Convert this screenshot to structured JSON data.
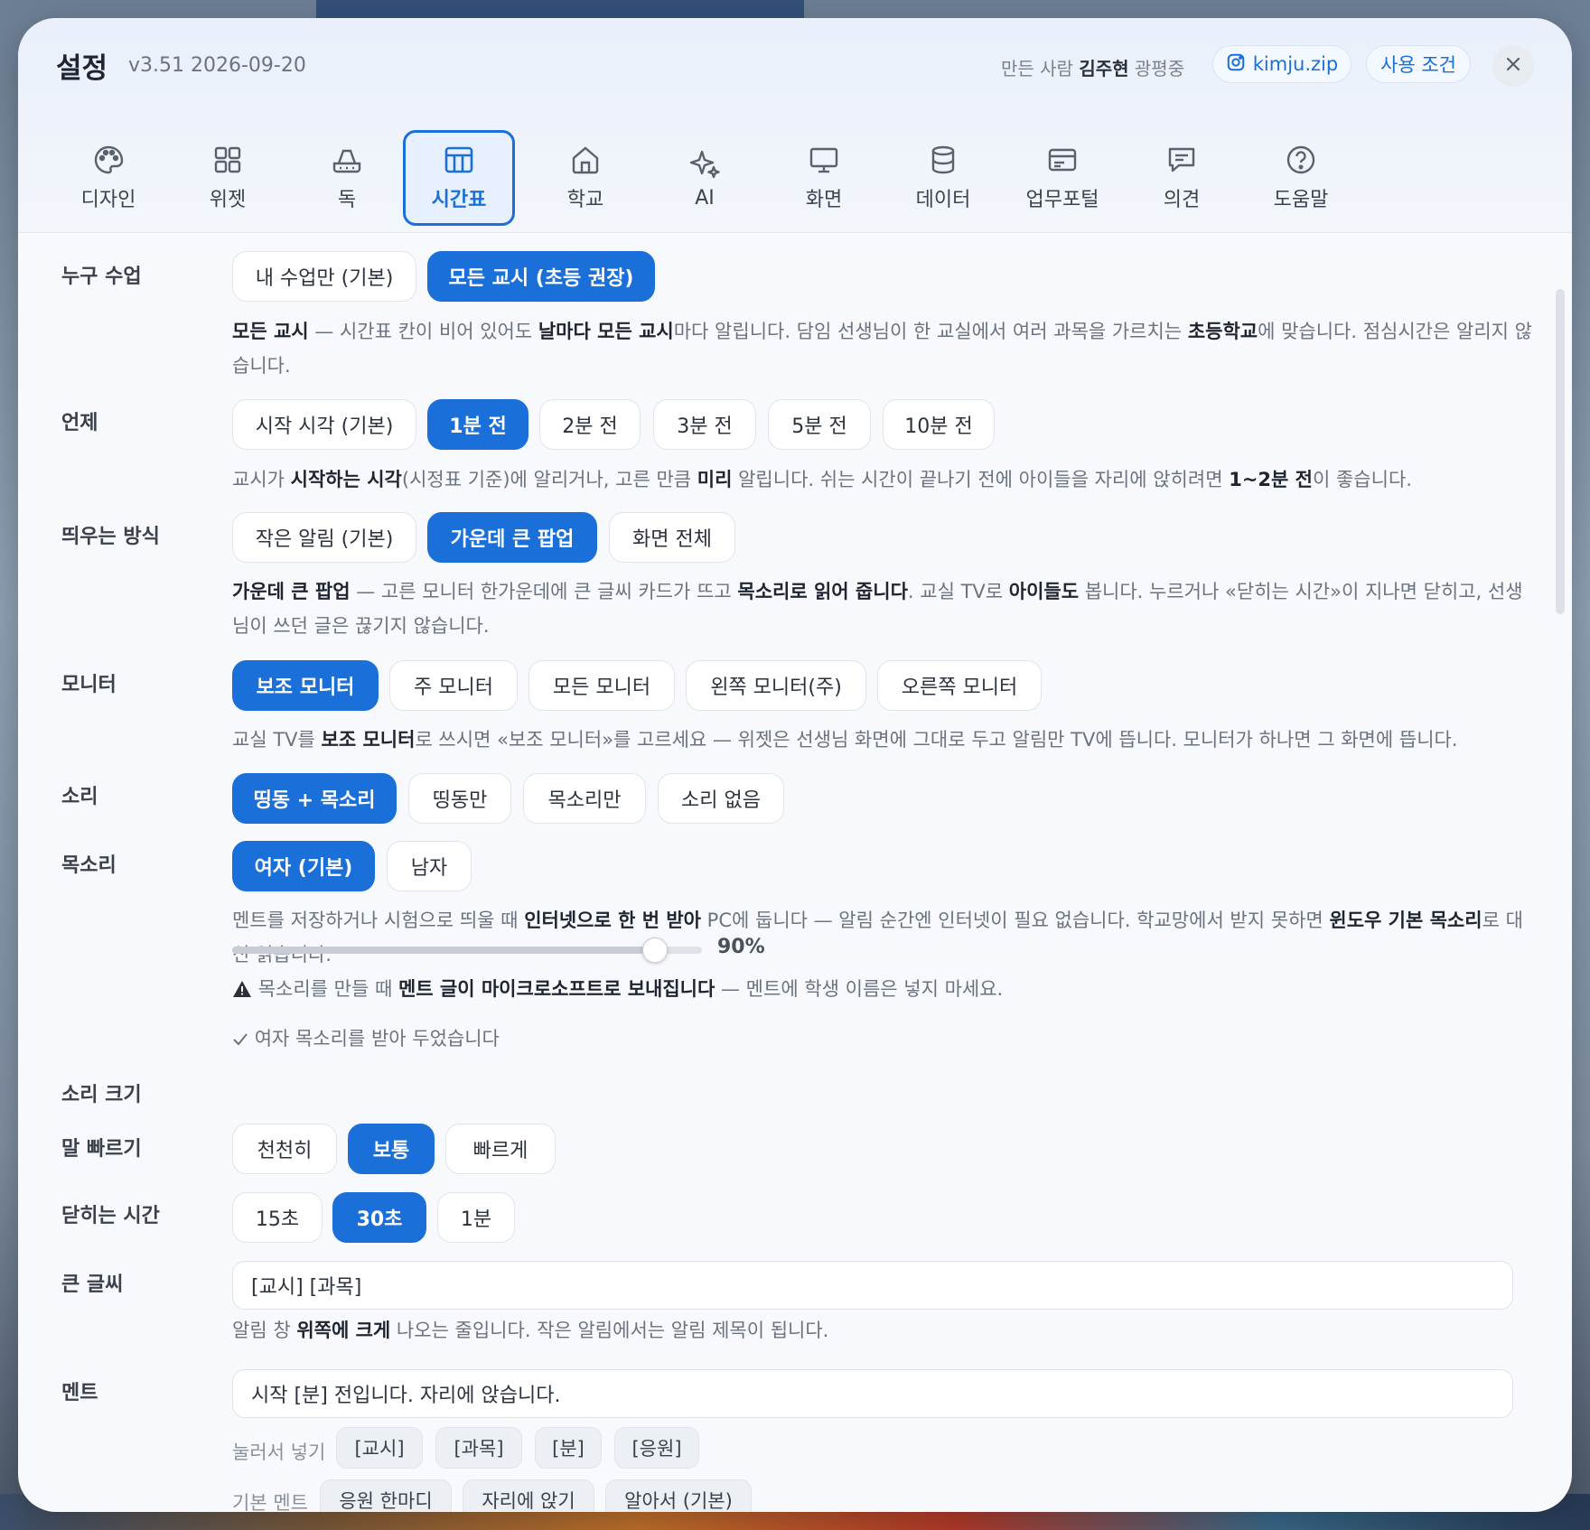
{
  "header": {
    "title": "설정",
    "version": "v3.51 2026-09-20",
    "maker_prefix": "만든 사람",
    "maker_name": "김주현",
    "maker_suffix": "광평중",
    "instagram_label": "kimju.zip",
    "terms_label": "사용 조건"
  },
  "tabs": [
    {
      "label": "디자인",
      "icon": "palette-icon"
    },
    {
      "label": "위젯",
      "icon": "grid-icon"
    },
    {
      "label": "독",
      "icon": "dock-icon"
    },
    {
      "label": "시간표",
      "icon": "table-icon",
      "active": true
    },
    {
      "label": "학교",
      "icon": "home-icon"
    },
    {
      "label": "AI",
      "icon": "sparkle-icon"
    },
    {
      "label": "화면",
      "icon": "monitor-icon"
    },
    {
      "label": "데이터",
      "icon": "database-icon"
    },
    {
      "label": "업무포털",
      "icon": "card-icon"
    },
    {
      "label": "의견",
      "icon": "chat-icon"
    },
    {
      "label": "도움말",
      "icon": "help-icon"
    }
  ],
  "colors": {
    "accent": "#1a6fd8",
    "text": "#1f2530",
    "muted": "#6b7380"
  },
  "who": {
    "label": "누구 수업",
    "options": [
      "내 수업만 (기본)",
      "모든 교시 (초등 권장)"
    ],
    "selected": 1,
    "desc": {
      "b1": "모든 교시",
      "t1": " — 시간표 칸이 비어 있어도 ",
      "b2": "날마다 모든 교시",
      "t2": "마다 알립니다. 담임 선생님이 한 교실에서 여러 과목을 가르치는 ",
      "b3": "초등학교",
      "t3": "에 맞습니다. 점심시간은 알리지 않습니다."
    }
  },
  "when": {
    "label": "언제",
    "options": [
      "시작 시각 (기본)",
      "1분 전",
      "2분 전",
      "3분 전",
      "5분 전",
      "10분 전"
    ],
    "selected": 1,
    "desc": {
      "t0": "교시가 ",
      "b1": "시작하는 시각",
      "t1": "(시정표 기준)에 알리거나, 고른 만큼 ",
      "b2": "미리",
      "t2": " 알립니다. 쉬는 시간이 끝나기 전에 아이들을 자리에 앉히려면 ",
      "b3": "1~2분 전",
      "t3": "이 좋습니다."
    }
  },
  "popup": {
    "label": "띄우는 방식",
    "options": [
      "작은 알림 (기본)",
      "가운데 큰 팝업",
      "화면 전체"
    ],
    "selected": 1,
    "desc": {
      "b1": "가운데 큰 팝업",
      "t1": " — 고른 모니터 한가운데에 큰 글씨 카드가 뜨고 ",
      "b2": "목소리로 읽어 줍니다",
      "t2": ". 교실 TV로 ",
      "b3": "아이들도",
      "t3": " 봅니다. 누르거나 «닫히는 시간»이 지나면 닫히고, 선생님이 쓰던 글은 끊기지 않습니다."
    }
  },
  "monitor": {
    "label": "모니터",
    "options": [
      "보조 모니터",
      "주 모니터",
      "모든 모니터",
      "왼쪽 모니터(주)",
      "오른쪽 모니터"
    ],
    "selected": 0,
    "desc": {
      "t0": "교실 TV를 ",
      "b1": "보조 모니터",
      "t1": "로 쓰시면 «보조 모니터»를 고르세요 — 위젯은 선생님 화면에 그대로 두고 알림만 TV에 뜹니다. 모니터가 하나면 그 화면에 뜹니다."
    }
  },
  "sound": {
    "label": "소리",
    "options": [
      "띵동 + 목소리",
      "띵동만",
      "목소리만",
      "소리 없음"
    ],
    "selected": 0
  },
  "voice": {
    "label": "목소리",
    "options": [
      "여자 (기본)",
      "남자"
    ],
    "selected": 0,
    "desc": {
      "t0": "멘트를 저장하거나 시험으로 띄울 때 ",
      "b1": "인터넷으로 한 번 받아",
      "t1": " PC에 둡니다 — 알림 순간엔 인터넷이 필요 없습니다. 학교망에서 받지 못하면 ",
      "b2": "윈도우 기본 목소리",
      "t2": "로 대신 읽습니다."
    },
    "warning": {
      "t0": "목소리를 만들 때 ",
      "b1": "멘트 글이 마이크로소프트로 보내집니다",
      "t1": " — 멘트에 학생 이름은 넣지 마세요."
    },
    "status": "여자 목소리를 받아 두었습니다"
  },
  "volume": {
    "label": "소리 크기",
    "value": 90,
    "value_text": "90%"
  },
  "speed": {
    "label": "말 빠르기",
    "options": [
      "천천히",
      "보통",
      "빠르게"
    ],
    "selected": 1
  },
  "close_time": {
    "label": "닫히는 시간",
    "options": [
      "15초",
      "30초",
      "1분"
    ],
    "selected": 1
  },
  "big_text": {
    "label": "큰 글씨",
    "value": "[교시] [과목]",
    "desc": {
      "t0": "알림 창 ",
      "b1": "위쪽에 크게",
      "t1": " 나오는 줄입니다. 작은 알림에서는 알림 제목이 됩니다."
    }
  },
  "ment": {
    "label": "멘트",
    "value": "시작 [분] 전입니다. 자리에 앉습니다.",
    "insert_label": "눌러서 넣기",
    "insert_chips": [
      "[교시]",
      "[과목]",
      "[분]",
      "[응원]"
    ],
    "preset_label": "기본 멘트",
    "preset_chips": [
      "응원 한마디",
      "자리에 앉기",
      "알아서 (기본)"
    ]
  }
}
